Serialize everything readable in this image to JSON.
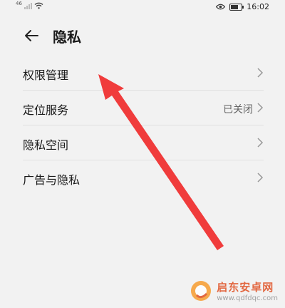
{
  "status_bar": {
    "network_type": "46",
    "time": "16:02",
    "eye_icon": "eye-comfort-icon",
    "battery_icon": "battery-icon"
  },
  "header": {
    "title": "隐私",
    "back_icon": "back-arrow-icon"
  },
  "list": {
    "items": [
      {
        "label": "权限管理",
        "value": ""
      },
      {
        "label": "定位服务",
        "value": "已关闭"
      },
      {
        "label": "隐私空间",
        "value": ""
      },
      {
        "label": "广告与隐私",
        "value": ""
      }
    ]
  },
  "annotation": {
    "color": "#f03c3c"
  },
  "watermark": {
    "name": "启东安卓网",
    "url": "www.qdfdqc.com"
  }
}
